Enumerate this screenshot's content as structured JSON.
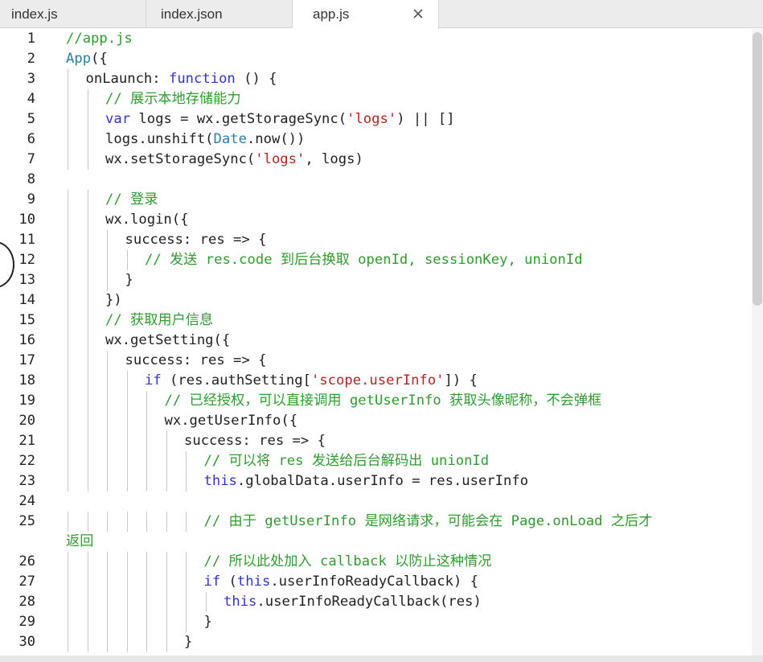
{
  "tabs": [
    {
      "label": "index.js"
    },
    {
      "label": "index.json"
    },
    {
      "label": "app.js",
      "active": true
    }
  ],
  "colors": {
    "comment": "#2f9b2f",
    "keyword": "#3434c4",
    "string": "#b32424",
    "builtin": "#2a7fa3"
  },
  "icons": {
    "close": "close-icon"
  },
  "code_lines": [
    {
      "n": "1",
      "depth": 0,
      "parts": [
        [
          "c",
          "//app.js"
        ]
      ]
    },
    {
      "n": "2",
      "depth": 0,
      "parts": [
        [
          "b",
          "App"
        ],
        [
          "p",
          "({"
        ]
      ]
    },
    {
      "n": "3",
      "depth": 1,
      "parts": [
        [
          "p",
          "onLaunch: "
        ],
        [
          "k",
          "function"
        ],
        [
          "p",
          " () {"
        ]
      ]
    },
    {
      "n": "4",
      "depth": 2,
      "parts": [
        [
          "c",
          "// 展示本地存储能力"
        ]
      ]
    },
    {
      "n": "5",
      "depth": 2,
      "parts": [
        [
          "k",
          "var"
        ],
        [
          "p",
          " logs = wx.getStorageSync("
        ],
        [
          "s",
          "'logs'"
        ],
        [
          "p",
          ") || []"
        ]
      ]
    },
    {
      "n": "6",
      "depth": 2,
      "parts": [
        [
          "p",
          "logs.unshift("
        ],
        [
          "b",
          "Date"
        ],
        [
          "p",
          ".now())"
        ]
      ]
    },
    {
      "n": "7",
      "depth": 2,
      "parts": [
        [
          "p",
          "wx.setStorageSync("
        ],
        [
          "s",
          "'logs'"
        ],
        [
          "p",
          ", logs)"
        ]
      ]
    },
    {
      "n": "8",
      "depth": 0,
      "parts": []
    },
    {
      "n": "9",
      "depth": 2,
      "parts": [
        [
          "c",
          "// 登录"
        ]
      ]
    },
    {
      "n": "10",
      "depth": 2,
      "parts": [
        [
          "p",
          "wx.login({"
        ]
      ]
    },
    {
      "n": "11",
      "depth": 3,
      "parts": [
        [
          "p",
          "success: res => {"
        ]
      ]
    },
    {
      "n": "12",
      "depth": 4,
      "parts": [
        [
          "c",
          "// 发送 res.code 到后台换取 openId, sessionKey, unionId"
        ]
      ]
    },
    {
      "n": "13",
      "depth": 3,
      "parts": [
        [
          "p",
          "}"
        ]
      ]
    },
    {
      "n": "14",
      "depth": 2,
      "parts": [
        [
          "p",
          "})"
        ]
      ]
    },
    {
      "n": "15",
      "depth": 2,
      "parts": [
        [
          "c",
          "// 获取用户信息"
        ]
      ]
    },
    {
      "n": "16",
      "depth": 2,
      "parts": [
        [
          "p",
          "wx.getSetting({"
        ]
      ]
    },
    {
      "n": "17",
      "depth": 3,
      "parts": [
        [
          "p",
          "success: res => {"
        ]
      ]
    },
    {
      "n": "18",
      "depth": 4,
      "parts": [
        [
          "k",
          "if"
        ],
        [
          "p",
          " (res.authSetting["
        ],
        [
          "s",
          "'scope.userInfo'"
        ],
        [
          "p",
          "]) {"
        ]
      ]
    },
    {
      "n": "19",
      "depth": 5,
      "parts": [
        [
          "c",
          "// 已经授权，可以直接调用 getUserInfo 获取头像昵称，不会弹框"
        ]
      ]
    },
    {
      "n": "20",
      "depth": 5,
      "parts": [
        [
          "p",
          "wx.getUserInfo({"
        ]
      ]
    },
    {
      "n": "21",
      "depth": 6,
      "parts": [
        [
          "p",
          "success: res => {"
        ]
      ]
    },
    {
      "n": "22",
      "depth": 7,
      "parts": [
        [
          "c",
          "// 可以将 res 发送给后台解码出 unionId"
        ]
      ]
    },
    {
      "n": "23",
      "depth": 7,
      "parts": [
        [
          "k",
          "this"
        ],
        [
          "p",
          ".globalData.userInfo = res.userInfo"
        ]
      ]
    },
    {
      "n": "24",
      "depth": 0,
      "parts": []
    },
    {
      "n": "25",
      "depth": 7,
      "parts": [
        [
          "c",
          "// 由于 getUserInfo 是网络请求，可能会在 Page.onLoad 之后才"
        ]
      ],
      "wrap": [
        [
          "c",
          "返回"
        ]
      ]
    },
    {
      "n": "26",
      "depth": 7,
      "parts": [
        [
          "c",
          "// 所以此处加入 callback 以防止这种情况"
        ]
      ]
    },
    {
      "n": "27",
      "depth": 7,
      "parts": [
        [
          "k",
          "if"
        ],
        [
          "p",
          " ("
        ],
        [
          "k",
          "this"
        ],
        [
          "p",
          ".userInfoReadyCallback) {"
        ]
      ]
    },
    {
      "n": "28",
      "depth": 8,
      "parts": [
        [
          "k",
          "this"
        ],
        [
          "p",
          ".userInfoReadyCallback(res)"
        ]
      ]
    },
    {
      "n": "29",
      "depth": 7,
      "parts": [
        [
          "p",
          "}"
        ]
      ]
    },
    {
      "n": "30",
      "depth": 6,
      "parts": [
        [
          "p",
          "}"
        ]
      ]
    }
  ]
}
